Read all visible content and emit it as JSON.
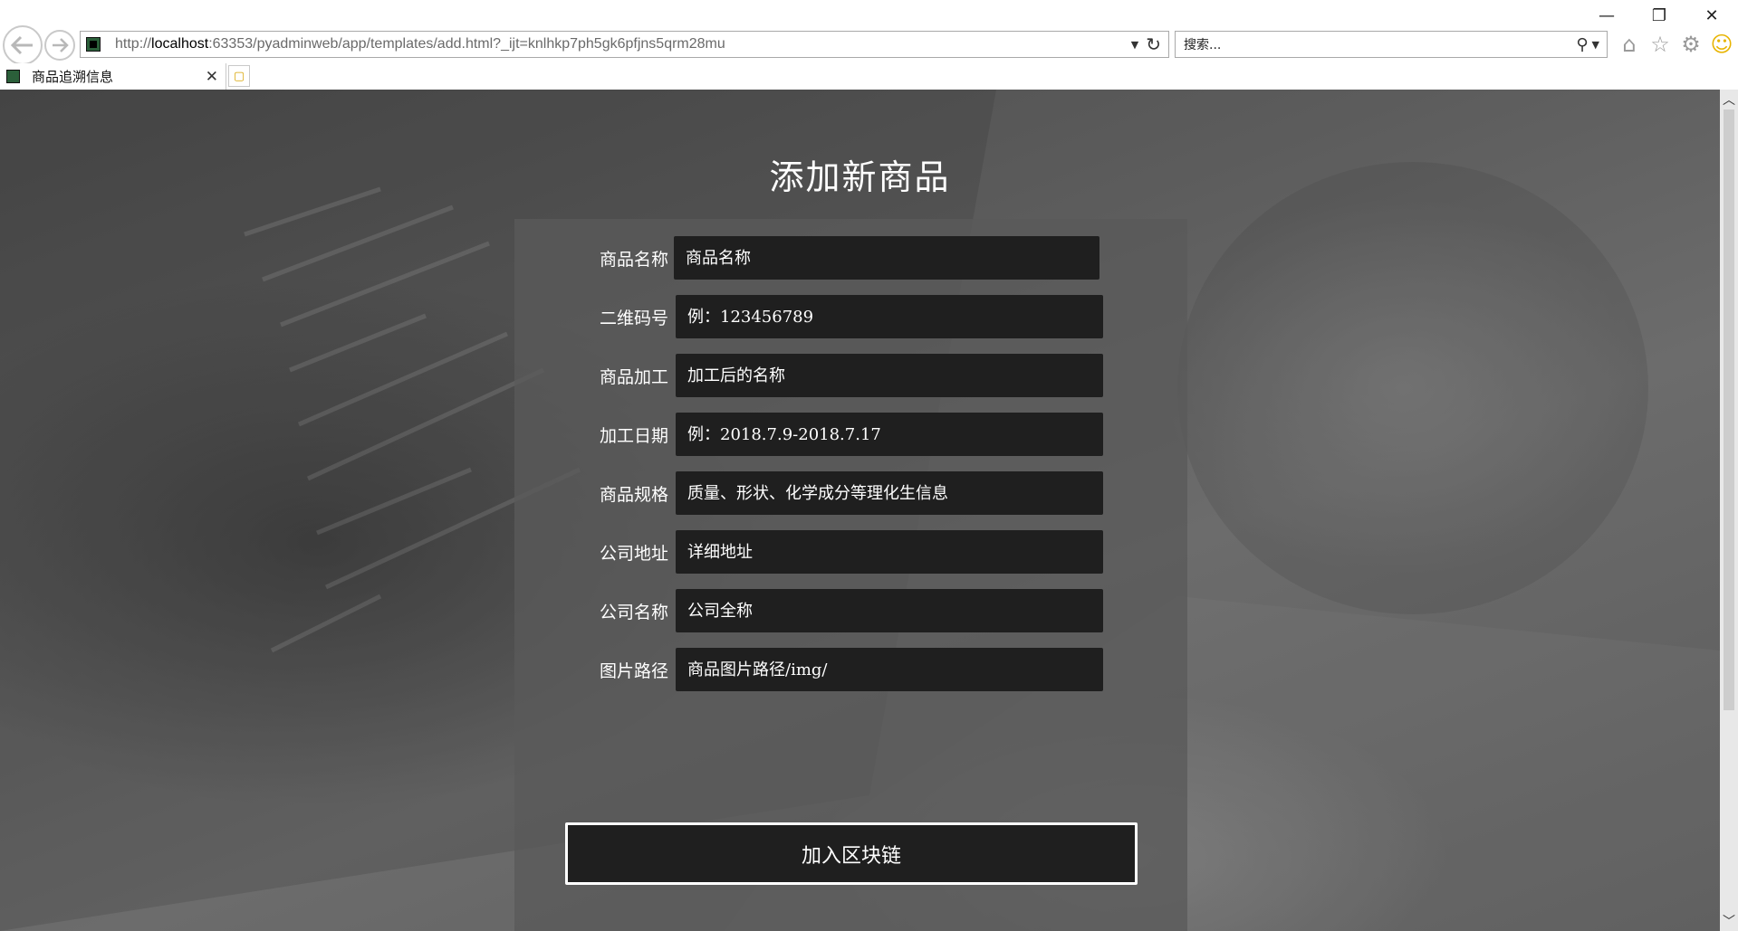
{
  "browser": {
    "url_prefix": "http://",
    "url_host": "localhost",
    "url_rest": ":63353/pyadminweb/app/templates/add.html?_ijt=knlhkp7ph5gk6pfjns5qrm28mu",
    "search_placeholder": "搜索...",
    "tab_title": "商品追溯信息",
    "icons": {
      "back": "back-arrow-icon",
      "forward": "forward-arrow-icon",
      "refresh": "refresh-icon",
      "search": "search-icon",
      "home": "home-icon",
      "favorites": "star-icon",
      "settings": "gear-icon",
      "feedback": "smiley-icon"
    },
    "window_controls": {
      "minimize": "—",
      "restore": "❐",
      "close": "✕"
    }
  },
  "page": {
    "title": "添加新商品",
    "fields": [
      {
        "label": "商品名称",
        "placeholder": "商品名称"
      },
      {
        "label": "二维码号",
        "placeholder": "例：123456789"
      },
      {
        "label": "商品加工",
        "placeholder": "加工后的名称"
      },
      {
        "label": "加工日期",
        "placeholder": "例：2018.7.9-2018.7.17"
      },
      {
        "label": "商品规格",
        "placeholder": "质量、形状、化学成分等理化生信息"
      },
      {
        "label": "公司地址",
        "placeholder": "详细地址"
      },
      {
        "label": "公司名称",
        "placeholder": "公司全称"
      },
      {
        "label": "图片路径",
        "placeholder": "商品图片路径/img/"
      }
    ],
    "submit_label": "加入区块链"
  },
  "colors": {
    "input_bg": "#1f1f1f",
    "panel_bg": "#5a5a5a",
    "text": "#ffffff"
  }
}
